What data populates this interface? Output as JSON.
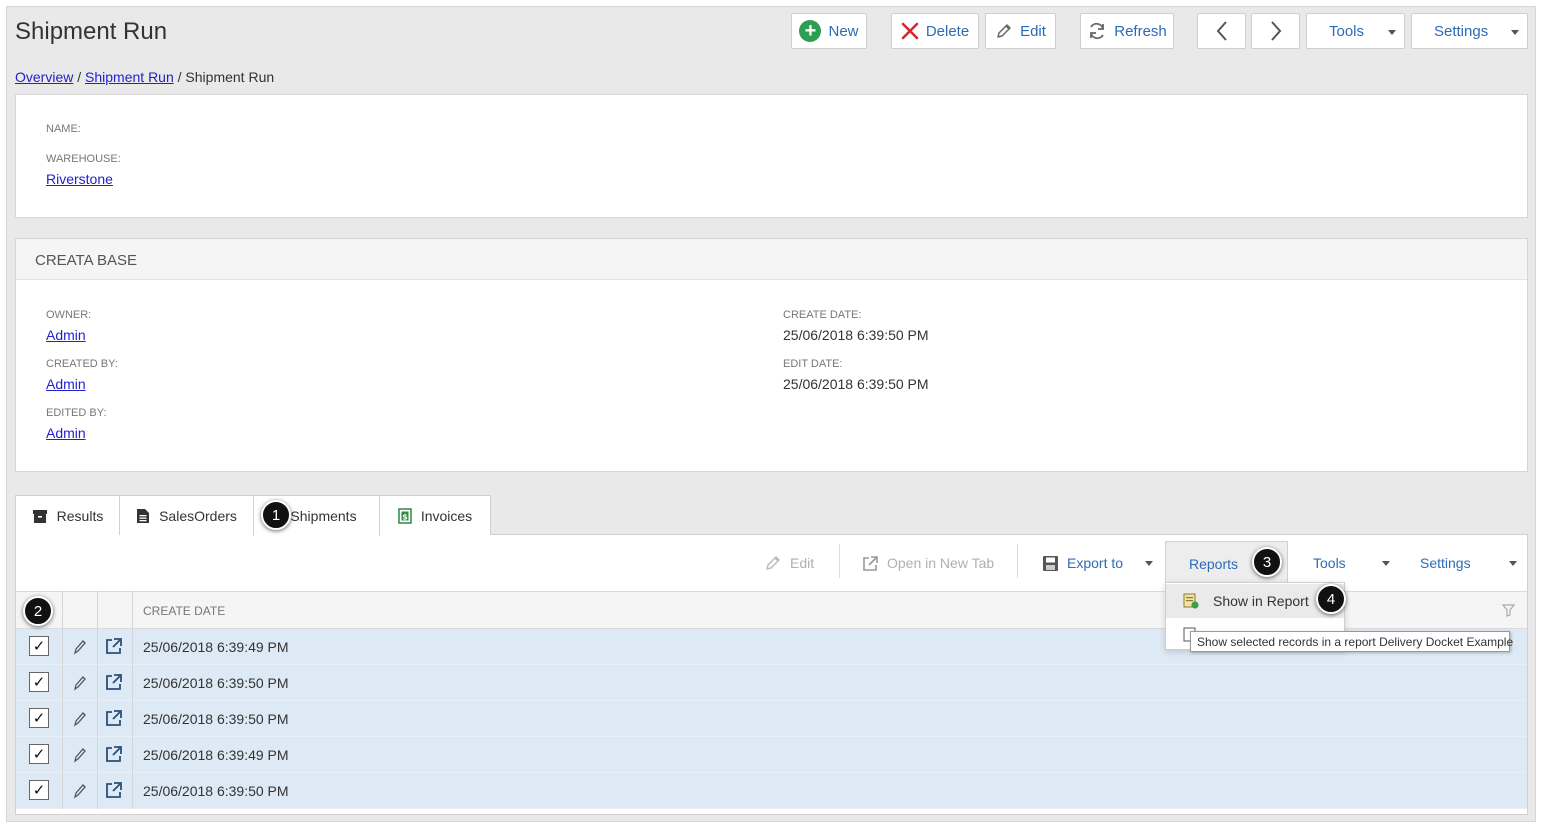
{
  "page": {
    "title": "Shipment Run"
  },
  "toolbar": {
    "new_label": "New",
    "delete_label": "Delete",
    "edit_label": "Edit",
    "refresh_label": "Refresh",
    "tools_label": "Tools",
    "settings_label": "Settings"
  },
  "breadcrumb": {
    "items": [
      "Overview",
      "Shipment Run",
      "Shipment Run"
    ],
    "separator": "/"
  },
  "details": {
    "name_label": "NAME:",
    "warehouse_label": "WAREHOUSE:",
    "warehouse_value": "Riverstone"
  },
  "creata_base": {
    "title": "CREATA BASE",
    "owner_label": "OWNER:",
    "owner_value": "Admin",
    "created_by_label": "CREATED BY:",
    "created_by_value": "Admin",
    "edited_by_label": "EDITED BY:",
    "edited_by_value": "Admin",
    "create_date_label": "CREATE DATE:",
    "create_date_value": "25/06/2018 6:39:50 PM",
    "edit_date_label": "EDIT DATE:",
    "edit_date_value": "25/06/2018 6:39:50 PM"
  },
  "tabs": [
    {
      "label": "Results"
    },
    {
      "label": "SalesOrders"
    },
    {
      "label": "Shipments"
    },
    {
      "label": "Invoices"
    }
  ],
  "grid_toolbar": {
    "edit_label": "Edit",
    "open_new_tab_label": "Open in New Tab",
    "export_label": "Export to",
    "reports_label": "Reports",
    "tools_label": "Tools",
    "settings_label": "Settings"
  },
  "grid": {
    "columns": [
      "CREATE DATE"
    ],
    "rows": [
      {
        "create_date": "25/06/2018 6:39:49 PM",
        "checked": true
      },
      {
        "create_date": "25/06/2018 6:39:50 PM",
        "checked": true
      },
      {
        "create_date": "25/06/2018 6:39:50 PM",
        "checked": true
      },
      {
        "create_date": "25/06/2018 6:39:49 PM",
        "checked": true
      },
      {
        "create_date": "25/06/2018 6:39:50 PM",
        "checked": true
      }
    ],
    "check_mark": "✓"
  },
  "reports_menu": {
    "items": [
      "Show in Report"
    ]
  },
  "tooltip": {
    "text": "Show selected records in a report Delivery Docket Example"
  },
  "step_badges": [
    "1",
    "2",
    "3",
    "4"
  ],
  "colors": {
    "link": "#2222cc",
    "accent": "#2d6bb6",
    "delete": "#d9262b",
    "new": "#2e9e55",
    "row_selected": "#dde9f5"
  }
}
